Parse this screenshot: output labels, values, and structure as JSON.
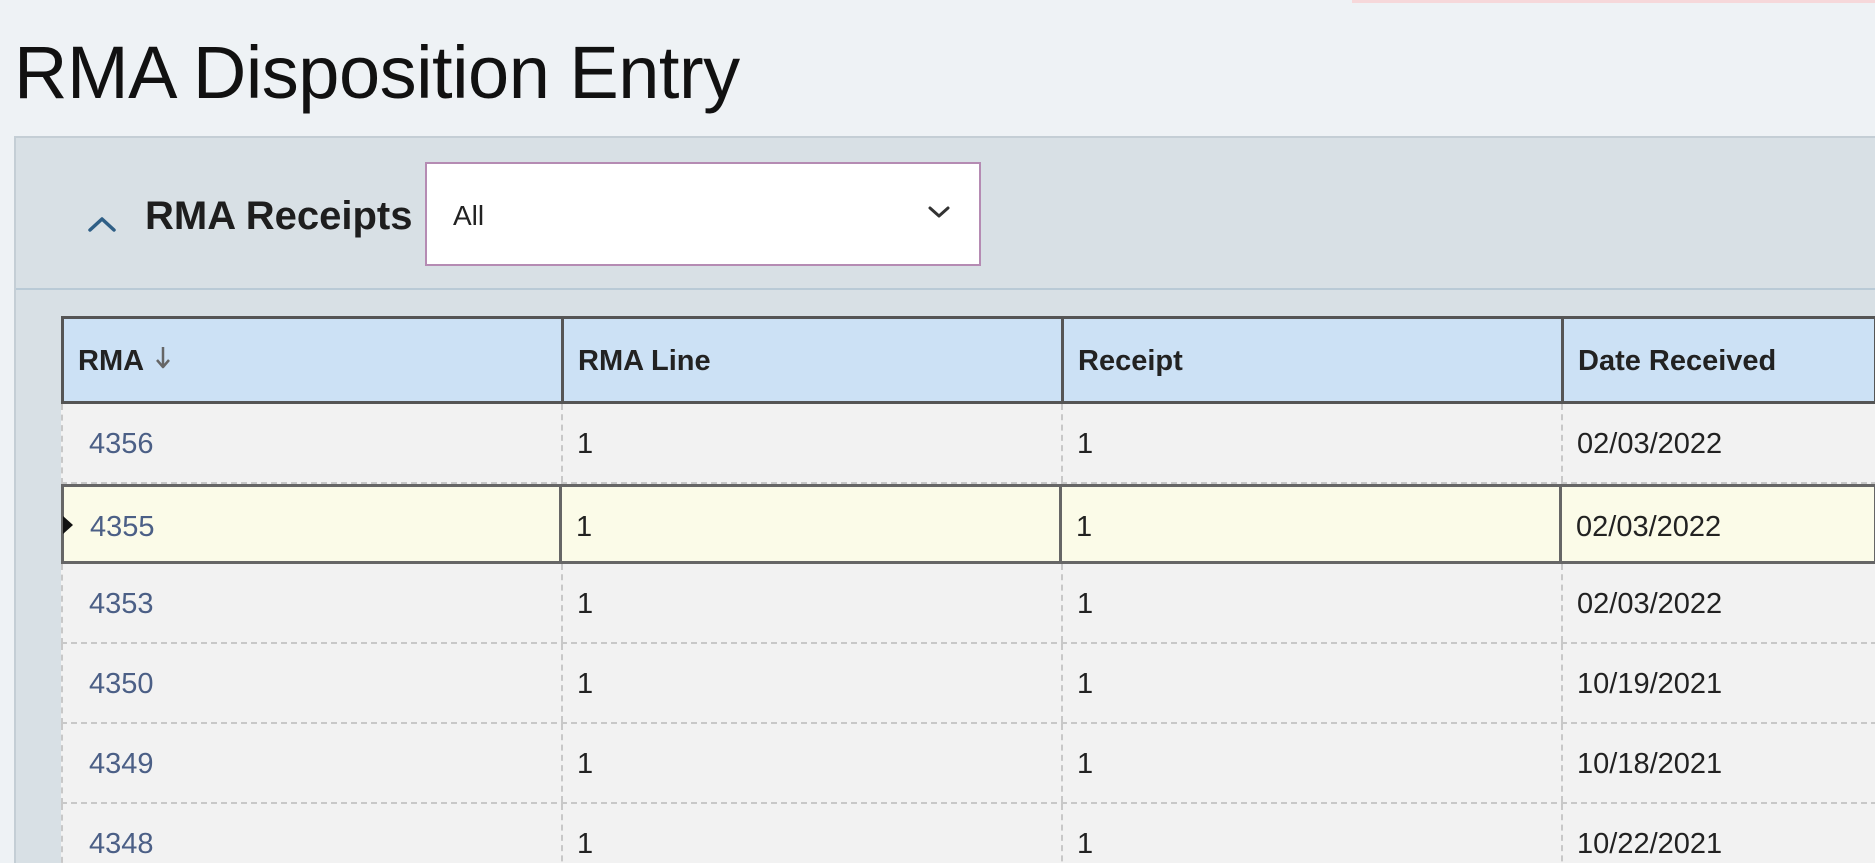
{
  "page": {
    "title": "RMA Disposition Entry"
  },
  "panel": {
    "title": "RMA Receipts",
    "collapse_icon": "chevron-up-icon",
    "filter": {
      "selected": "All",
      "icon": "chevron-down-icon"
    }
  },
  "grid": {
    "columns": [
      {
        "label": "RMA",
        "sorted": "descending"
      },
      {
        "label": "RMA Line"
      },
      {
        "label": "Receipt"
      },
      {
        "label": "Date Received"
      }
    ],
    "rows": [
      {
        "rma": "4356",
        "rma_line": "1",
        "receipt": "1",
        "date_received": "02/03/2022",
        "selected": false
      },
      {
        "rma": "4355",
        "rma_line": "1",
        "receipt": "1",
        "date_received": "02/03/2022",
        "selected": true
      },
      {
        "rma": "4353",
        "rma_line": "1",
        "receipt": "1",
        "date_received": "02/03/2022",
        "selected": false
      },
      {
        "rma": "4350",
        "rma_line": "1",
        "receipt": "1",
        "date_received": "10/19/2021",
        "selected": false
      },
      {
        "rma": "4349",
        "rma_line": "1",
        "receipt": "1",
        "date_received": "10/18/2021",
        "selected": false
      },
      {
        "rma": "4348",
        "rma_line": "1",
        "receipt": "1",
        "date_received": "10/22/2021",
        "selected": false
      }
    ]
  },
  "colors": {
    "header_bg": "#cce1f5",
    "selected_row_bg": "#fbfbe8",
    "link": "#4b5f86",
    "select_border": "#b58bb3"
  }
}
